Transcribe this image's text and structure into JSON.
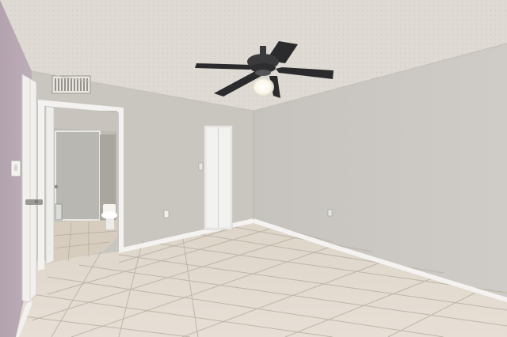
{
  "scene": {
    "kind": "empty bedroom photo",
    "elements": {
      "ceiling": "textured-ceiling",
      "ceiling_fan": "ceiling-fan-with-light",
      "vent": "hvac-vent",
      "left_door": "open-door",
      "doorway": "bathroom-doorway",
      "closet": "closet-door",
      "floor": "tile-floor",
      "baseboard": "white-baseboard",
      "outlets": "wall-outlets",
      "light_switch": "light-switch"
    },
    "colors": {
      "ceiling": "#dedad3",
      "back_wall": "#c9c6c0",
      "right_wall": "#cbc8c3",
      "left_wall": "#b6a7b2",
      "trim": "#f2f2f0",
      "floor": "#e2d9cf",
      "grout": "#b4a99e",
      "fan_dark": "#2b2b2d",
      "fan_light": "#fffdf5",
      "bathroom_wall": "#bdbbb4",
      "bathroom_floor": "#d7cdbf"
    }
  }
}
